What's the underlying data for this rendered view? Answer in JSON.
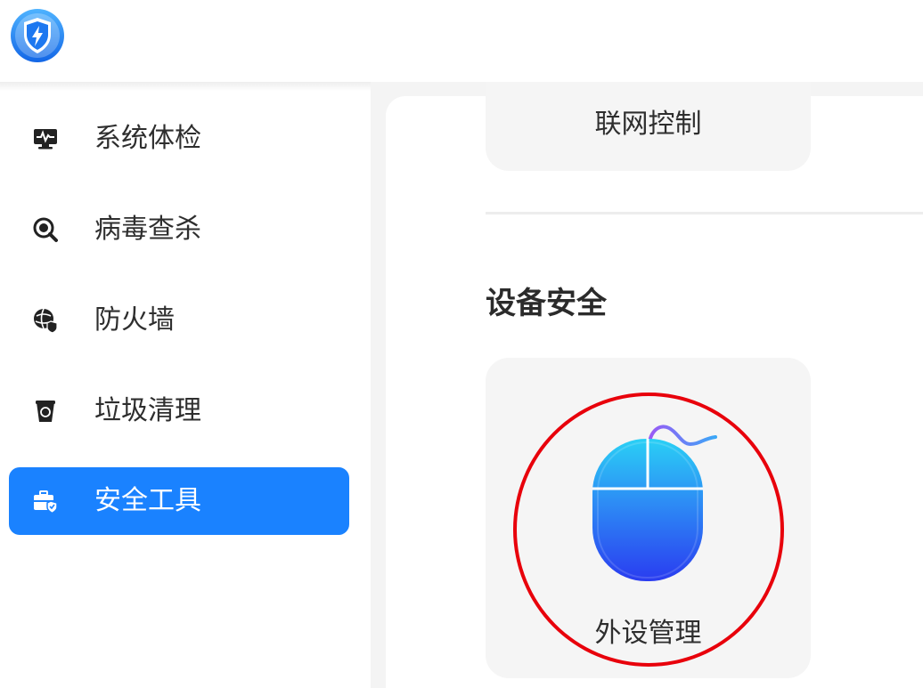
{
  "app": {
    "logo_icon": "shield-bolt-icon"
  },
  "sidebar": {
    "items": [
      {
        "label": "系统体检",
        "icon": "monitor-pulse-icon",
        "active": false
      },
      {
        "label": "病毒查杀",
        "icon": "virus-scan-icon",
        "active": false
      },
      {
        "label": "防火墙",
        "icon": "firewall-globe-icon",
        "active": false
      },
      {
        "label": "垃圾清理",
        "icon": "trash-can-icon",
        "active": false
      },
      {
        "label": "安全工具",
        "icon": "toolbox-shield-icon",
        "active": true
      }
    ]
  },
  "main": {
    "network_card": {
      "label": "联网控制"
    },
    "device_section": {
      "title": "设备安全",
      "peripheral_card": {
        "label": "外设管理",
        "icon": "mouse-icon"
      }
    }
  },
  "colors": {
    "accent": "#1a82ff",
    "highlight_ring": "#e8000b",
    "card_bg": "#f5f5f5"
  }
}
